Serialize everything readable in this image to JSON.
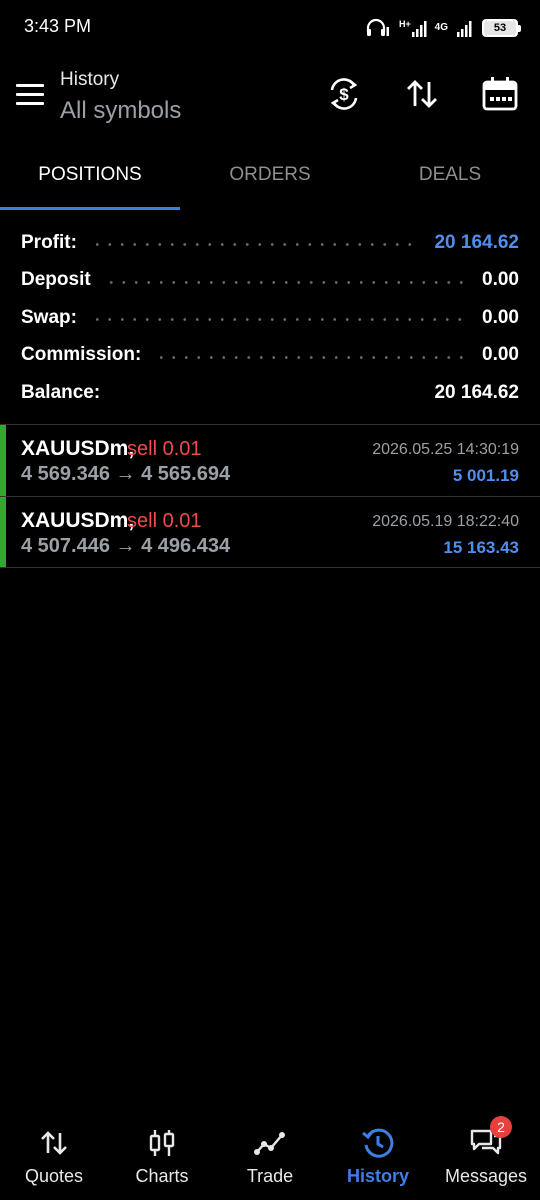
{
  "status_bar": {
    "time": "3:43 PM",
    "network_label": "4G",
    "battery": "53"
  },
  "header": {
    "title": "History",
    "subtitle": "All symbols"
  },
  "tabs": [
    {
      "label": "POSITIONS",
      "active": true
    },
    {
      "label": "ORDERS",
      "active": false
    },
    {
      "label": "DEALS",
      "active": false
    }
  ],
  "summary": {
    "profit_label": "Profit:",
    "profit_value": "20 164.62",
    "deposit_label": "Deposit",
    "deposit_value": "0.00",
    "swap_label": "Swap:",
    "swap_value": "0.00",
    "commission_label": "Commission:",
    "commission_value": "0.00",
    "balance_label": "Balance:",
    "balance_value": "20 164.62"
  },
  "positions": [
    {
      "symbol": "XAUUSDm",
      "separator": ",",
      "type": "sell 0.01",
      "prices": "4 569.346 → 4 565.694",
      "time": "2026.05.25 14:30:19",
      "profit": "5 001.19"
    },
    {
      "symbol": "XAUUSDm",
      "separator": ",",
      "type": "sell 0.01",
      "prices": "4 507.446 → 4 496.434",
      "time": "2026.05.19 18:22:40",
      "profit": "15 163.43"
    }
  ],
  "bottom_nav": [
    {
      "label": "Quotes",
      "icon": "quotes-icon",
      "active": false
    },
    {
      "label": "Charts",
      "icon": "charts-icon",
      "active": false
    },
    {
      "label": "Trade",
      "icon": "trade-icon",
      "active": false
    },
    {
      "label": "History",
      "icon": "history-icon",
      "active": true
    },
    {
      "label": "Messages",
      "icon": "messages-icon",
      "active": false,
      "badge": "2"
    }
  ],
  "colors": {
    "accent": "#3d7fe6",
    "profit_blue": "#4f8ff0",
    "sell_red": "#f24a4a",
    "position_bar_green": "#3aa335",
    "background": "#000000"
  }
}
